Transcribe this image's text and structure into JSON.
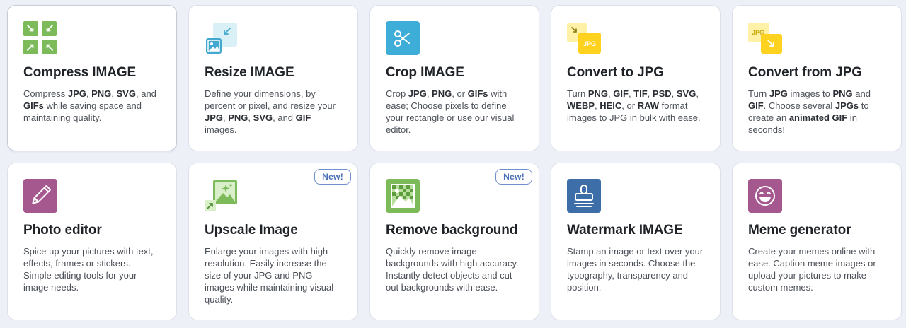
{
  "tools": [
    {
      "title": "Compress IMAGE",
      "icon": "compress-icon",
      "desc": [
        {
          "t": "Compress "
        },
        {
          "t": "JPG",
          "b": true
        },
        {
          "t": ", "
        },
        {
          "t": "PNG",
          "b": true
        },
        {
          "t": ", "
        },
        {
          "t": "SVG",
          "b": true
        },
        {
          "t": ", and "
        },
        {
          "t": "GIFs",
          "b": true
        },
        {
          "t": " while saving space and maintaining quality."
        }
      ]
    },
    {
      "title": "Resize IMAGE",
      "icon": "resize-icon",
      "desc": [
        {
          "t": "Define your dimensions, by percent or pixel, and resize your "
        },
        {
          "t": "JPG",
          "b": true
        },
        {
          "t": ", "
        },
        {
          "t": "PNG",
          "b": true
        },
        {
          "t": ", "
        },
        {
          "t": "SVG",
          "b": true
        },
        {
          "t": ", and "
        },
        {
          "t": "GIF",
          "b": true
        },
        {
          "t": " images."
        }
      ]
    },
    {
      "title": "Crop IMAGE",
      "icon": "crop-icon",
      "desc": [
        {
          "t": "Crop "
        },
        {
          "t": "JPG",
          "b": true
        },
        {
          "t": ", "
        },
        {
          "t": "PNG",
          "b": true
        },
        {
          "t": ", or "
        },
        {
          "t": "GIFs",
          "b": true
        },
        {
          "t": " with ease; Choose pixels to define your rectangle or use our visual editor."
        }
      ]
    },
    {
      "title": "Convert to JPG",
      "icon": "convert-to-jpg-icon",
      "icon_label": "JPG",
      "desc": [
        {
          "t": "Turn "
        },
        {
          "t": "PNG",
          "b": true
        },
        {
          "t": ", "
        },
        {
          "t": "GIF",
          "b": true
        },
        {
          "t": ", "
        },
        {
          "t": "TIF",
          "b": true
        },
        {
          "t": ", "
        },
        {
          "t": "PSD",
          "b": true
        },
        {
          "t": ", "
        },
        {
          "t": "SVG",
          "b": true
        },
        {
          "t": ", "
        },
        {
          "t": "WEBP",
          "b": true
        },
        {
          "t": ", "
        },
        {
          "t": "HEIC",
          "b": true
        },
        {
          "t": ", or "
        },
        {
          "t": "RAW",
          "b": true
        },
        {
          "t": " format images to JPG in bulk with ease."
        }
      ]
    },
    {
      "title": "Convert from JPG",
      "icon": "convert-from-jpg-icon",
      "icon_label": "JPG",
      "desc": [
        {
          "t": "Turn "
        },
        {
          "t": "JPG",
          "b": true
        },
        {
          "t": " images to "
        },
        {
          "t": "PNG",
          "b": true
        },
        {
          "t": " and "
        },
        {
          "t": "GIF",
          "b": true
        },
        {
          "t": ". Choose several "
        },
        {
          "t": "JPGs",
          "b": true
        },
        {
          "t": " to create an "
        },
        {
          "t": "animated GIF",
          "b": true
        },
        {
          "t": " in seconds!"
        }
      ]
    },
    {
      "title": "Photo editor",
      "icon": "pencil-icon",
      "desc": [
        {
          "t": "Spice up your pictures with text, effects, frames or stickers. Simple editing tools for your image needs."
        }
      ]
    },
    {
      "title": "Upscale Image",
      "icon": "upscale-icon",
      "badge": "New!",
      "desc": [
        {
          "t": "Enlarge your images with high resolution. Easily increase the size of your JPG and PNG images while maintaining visual quality."
        }
      ]
    },
    {
      "title": "Remove background",
      "icon": "remove-background-icon",
      "badge": "New!",
      "desc": [
        {
          "t": "Quickly remove image backgrounds with high accuracy. Instantly detect objects and cut out backgrounds with ease."
        }
      ]
    },
    {
      "title": "Watermark IMAGE",
      "icon": "stamp-icon",
      "desc": [
        {
          "t": "Stamp an image or text over your images in seconds. Choose the typography, transparency and position."
        }
      ]
    },
    {
      "title": "Meme generator",
      "icon": "laughing-face-icon",
      "desc": [
        {
          "t": "Create your memes online with ease. Caption meme images or upload your pictures to make custom memes."
        }
      ]
    }
  ],
  "colors": {
    "compress": "#7dba5a",
    "resize_light": "#d8f0f6",
    "resize_dark": "#43a8cf",
    "crop": "#3eaed9",
    "jpg_yellow": "#ffd21f",
    "jpg_yellow_light": "#fff2a8",
    "photo_editor": "#a4588e",
    "upscale_green": "#7dba5a",
    "remove_bg": "#7dba5a",
    "watermark": "#3d6ea8",
    "meme": "#a4588e",
    "badge_border": "#6f8fcf"
  }
}
